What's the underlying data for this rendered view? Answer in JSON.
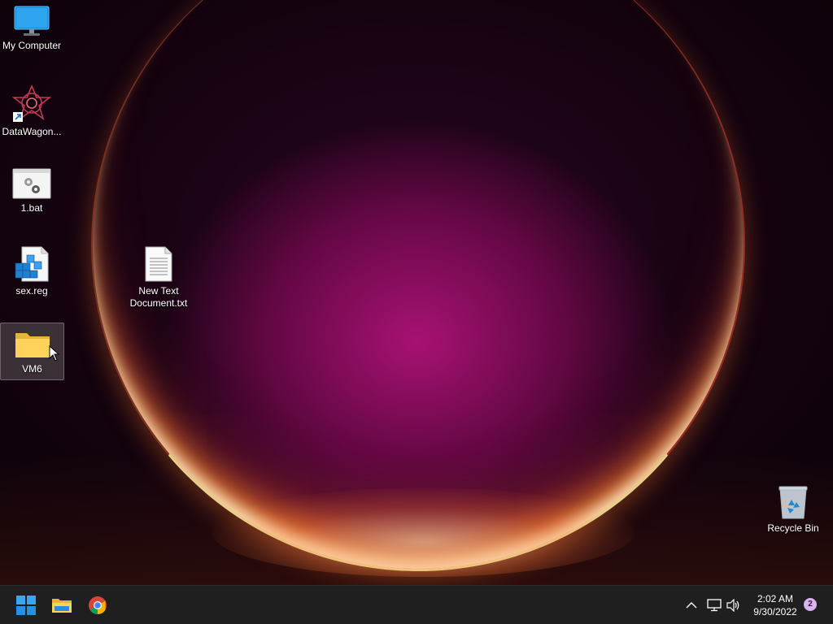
{
  "desktop": {
    "icons": [
      {
        "label": "My Computer",
        "icon": "monitor-icon"
      },
      {
        "label": "DataWagon...",
        "icon": "datawagon-app-icon",
        "shortcut": true
      },
      {
        "label": "1.bat",
        "icon": "batch-file-icon"
      },
      {
        "label": "sex.reg",
        "icon": "registry-file-icon"
      },
      {
        "label": "VM6",
        "icon": "folder-icon",
        "selected": true
      },
      {
        "label": "New Text Document.txt",
        "icon": "text-file-icon"
      },
      {
        "label": "Recycle Bin",
        "icon": "recycle-bin-icon"
      }
    ]
  },
  "taskbar": {
    "pinned": [
      {
        "name": "start",
        "icon": "windows-logo-icon"
      },
      {
        "name": "file-explorer",
        "icon": "file-explorer-icon"
      },
      {
        "name": "chrome",
        "icon": "chrome-icon"
      }
    ],
    "tray": {
      "icons": [
        "chevron-up-icon",
        "network-icon",
        "volume-icon"
      ],
      "time": "2:02 AM",
      "date": "9/30/2022",
      "notification_count": "2"
    }
  },
  "colors": {
    "taskbar_bg": "#1f1f1f",
    "accent_blue": "#0078d4",
    "badge": "#d9b3f0"
  }
}
